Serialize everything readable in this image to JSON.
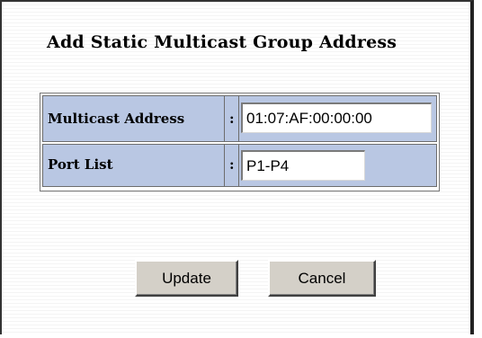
{
  "form": {
    "title": "Add Static Multicast Group Address",
    "fields": [
      {
        "label": "Multicast Address",
        "separator": ":",
        "value": "01:07:AF:00:00:00"
      },
      {
        "label": "Port List",
        "separator": ":",
        "value": "P1-P4"
      }
    ]
  },
  "buttons": {
    "update_label": "Update",
    "cancel_label": "Cancel"
  },
  "colors": {
    "row_background": "#b9c7e3",
    "button_face": "#d4d0c8"
  }
}
